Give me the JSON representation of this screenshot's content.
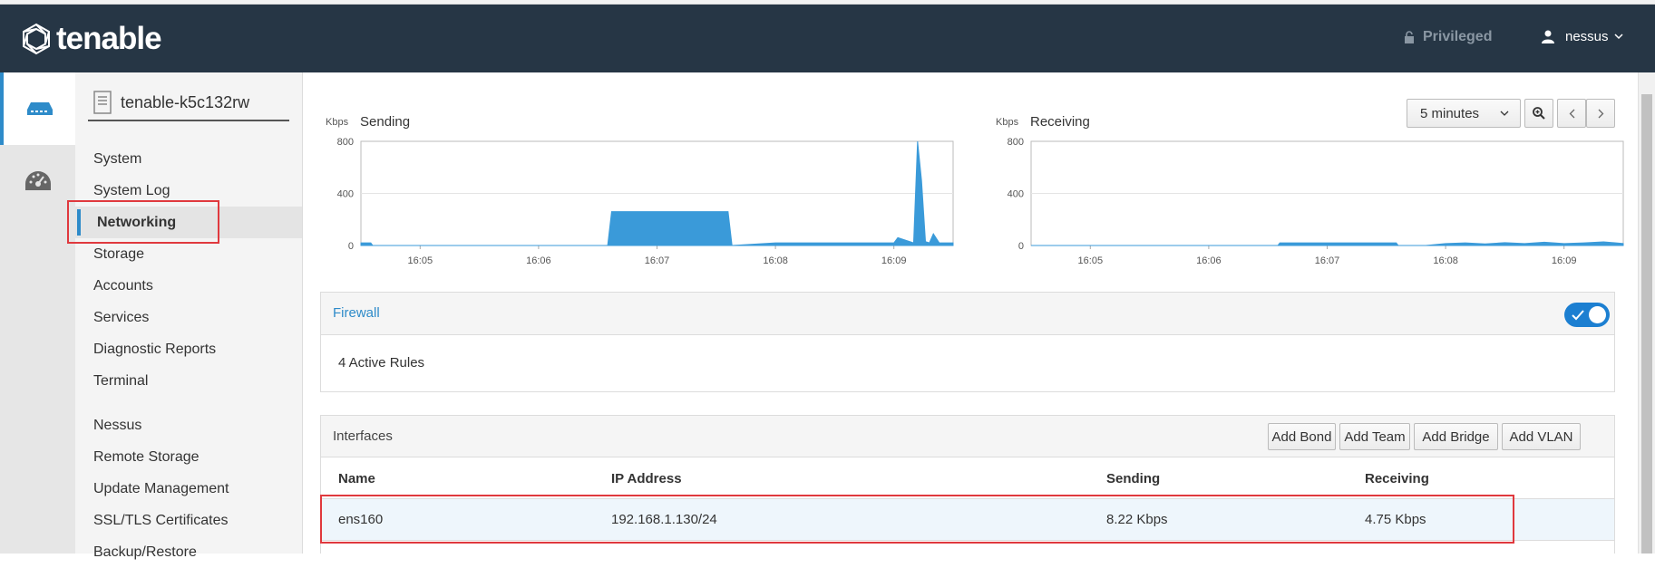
{
  "header": {
    "brand": "tenable",
    "privileged_label": "Privileged",
    "user_label": "nessus"
  },
  "sidebar": {
    "host_name": "tenable-k5c132rw",
    "items": [
      {
        "label": "System"
      },
      {
        "label": "System Log"
      },
      {
        "label": "Networking",
        "active": true
      },
      {
        "label": "Storage"
      },
      {
        "label": "Accounts"
      },
      {
        "label": "Services"
      },
      {
        "label": "Diagnostic Reports"
      },
      {
        "label": "Terminal"
      },
      {
        "label": "Nessus"
      },
      {
        "label": "Remote Storage"
      },
      {
        "label": "Update Management"
      },
      {
        "label": "SSL/TLS Certificates"
      },
      {
        "label": "Backup/Restore"
      }
    ]
  },
  "toolbar": {
    "range_selected": "5 minutes"
  },
  "chart_data": [
    {
      "type": "area",
      "title": "Sending",
      "ylabel": "Kbps",
      "ylim": [
        0,
        800
      ],
      "yticks": [
        "800",
        "400",
        "0"
      ],
      "xticks": [
        "16:05",
        "16:06",
        "16:07",
        "16:08",
        "16:09"
      ],
      "color": "#3a9ad9",
      "x": [
        "16:04:30",
        "16:04:35",
        "16:04:36",
        "16:06:35",
        "16:06:37",
        "16:07:36",
        "16:07:38",
        "16:08:00",
        "16:08:10",
        "16:08:30",
        "16:08:50",
        "16:09:00",
        "16:09:02",
        "16:09:10",
        "16:09:12",
        "16:09:14",
        "16:09:16",
        "16:09:18",
        "16:09:20",
        "16:09:23",
        "16:09:26",
        "16:09:30"
      ],
      "values": [
        20,
        20,
        0,
        0,
        260,
        260,
        0,
        20,
        20,
        20,
        20,
        20,
        60,
        20,
        800,
        500,
        30,
        20,
        90,
        20,
        20,
        20
      ]
    },
    {
      "type": "area",
      "title": "Receiving",
      "ylabel": "Kbps",
      "ylim": [
        0,
        800
      ],
      "yticks": [
        "800",
        "400",
        "0"
      ],
      "xticks": [
        "16:05",
        "16:06",
        "16:07",
        "16:08",
        "16:09"
      ],
      "color": "#3a9ad9",
      "x": [
        "16:04:30",
        "16:06:35",
        "16:06:36",
        "16:07:35",
        "16:07:36",
        "16:07:50",
        "16:08:00",
        "16:08:10",
        "16:08:20",
        "16:08:30",
        "16:08:40",
        "16:08:50",
        "16:09:00",
        "16:09:10",
        "16:09:20",
        "16:09:30"
      ],
      "values": [
        0,
        0,
        20,
        20,
        0,
        0,
        15,
        20,
        12,
        22,
        15,
        25,
        15,
        20,
        28,
        15
      ]
    }
  ],
  "firewall": {
    "title": "Firewall",
    "rules_text": "4 Active Rules",
    "enabled": true
  },
  "interfaces": {
    "title": "Interfaces",
    "buttons": [
      "Add Bond",
      "Add Team",
      "Add Bridge",
      "Add VLAN"
    ],
    "columns": [
      "Name",
      "IP Address",
      "Sending",
      "Receiving"
    ],
    "rows": [
      {
        "name": "ens160",
        "ip": "192.168.1.130/24",
        "sending": "8.22 Kbps",
        "receiving": "4.75 Kbps"
      }
    ]
  }
}
